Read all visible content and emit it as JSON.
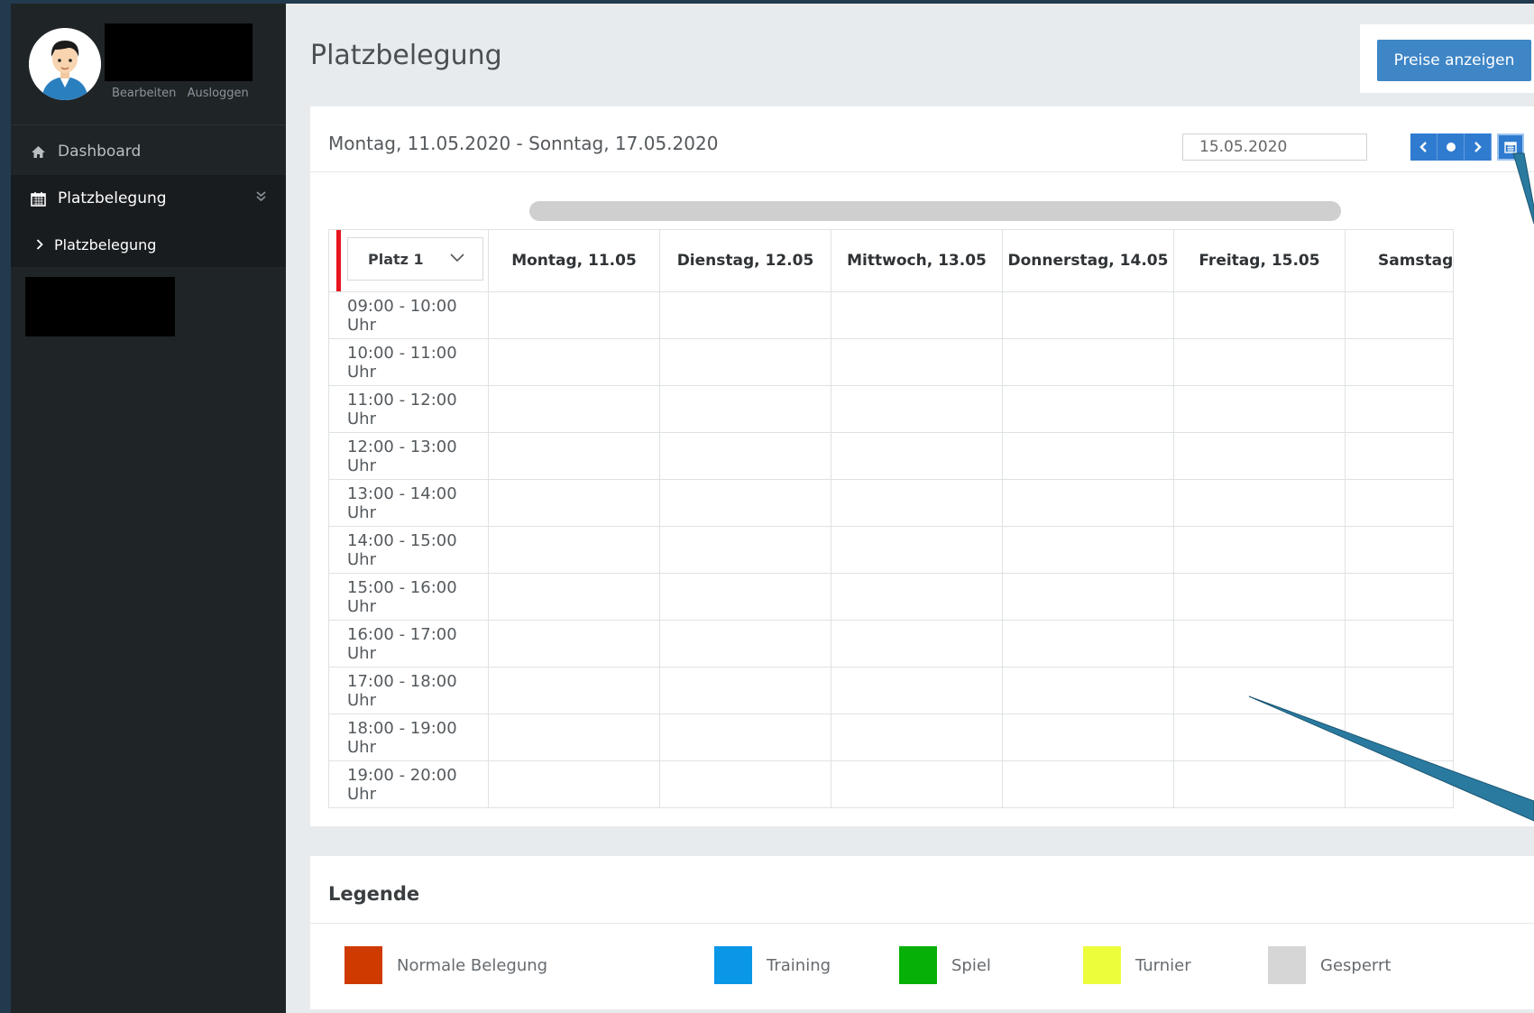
{
  "sidebar": {
    "profile_links": [
      "Bearbeiten",
      "Ausloggen"
    ],
    "nav": {
      "dashboard": "Dashboard",
      "platzbelegung": "Platzbelegung",
      "sub_platzbelegung": "Platzbelegung"
    }
  },
  "header": {
    "title": "Platzbelegung",
    "preise_button": "Preise anzeigen"
  },
  "calendar": {
    "week_range": "Montag, 11.05.2020 - Sonntag, 17.05.2020",
    "date_value": "15.05.2020",
    "platz_select": "Platz 1",
    "days": [
      "Montag, 11.05",
      "Dienstag, 12.05",
      "Mittwoch, 13.05",
      "Donnerstag, 14.05",
      "Freitag, 15.05",
      "Samstag"
    ],
    "times": [
      "09:00 - 10:00 Uhr",
      "10:00 - 11:00 Uhr",
      "11:00 - 12:00 Uhr",
      "12:00 - 13:00 Uhr",
      "13:00 - 14:00 Uhr",
      "14:00 - 15:00 Uhr",
      "15:00 - 16:00 Uhr",
      "16:00 - 17:00 Uhr",
      "17:00 - 18:00 Uhr",
      "18:00 - 19:00 Uhr",
      "19:00 - 20:00 Uhr"
    ]
  },
  "legend": {
    "title": "Legende",
    "items": [
      {
        "label": "Normale Belegung",
        "color": "#cf3a00"
      },
      {
        "label": "Training",
        "color": "#0a97e8"
      },
      {
        "label": "Spiel",
        "color": "#07b007"
      },
      {
        "label": "Turnier",
        "color": "#ecfd3c"
      },
      {
        "label": "Gesperrt",
        "color": "#d6d6d6"
      }
    ]
  },
  "colors": {
    "sidebar_bg": "#1f2427",
    "accent_button": "#3f86c7",
    "nav_button": "#2f7bd0",
    "highlight_box": "#e8141e",
    "annotation_arrow": "#2a7aa0"
  }
}
